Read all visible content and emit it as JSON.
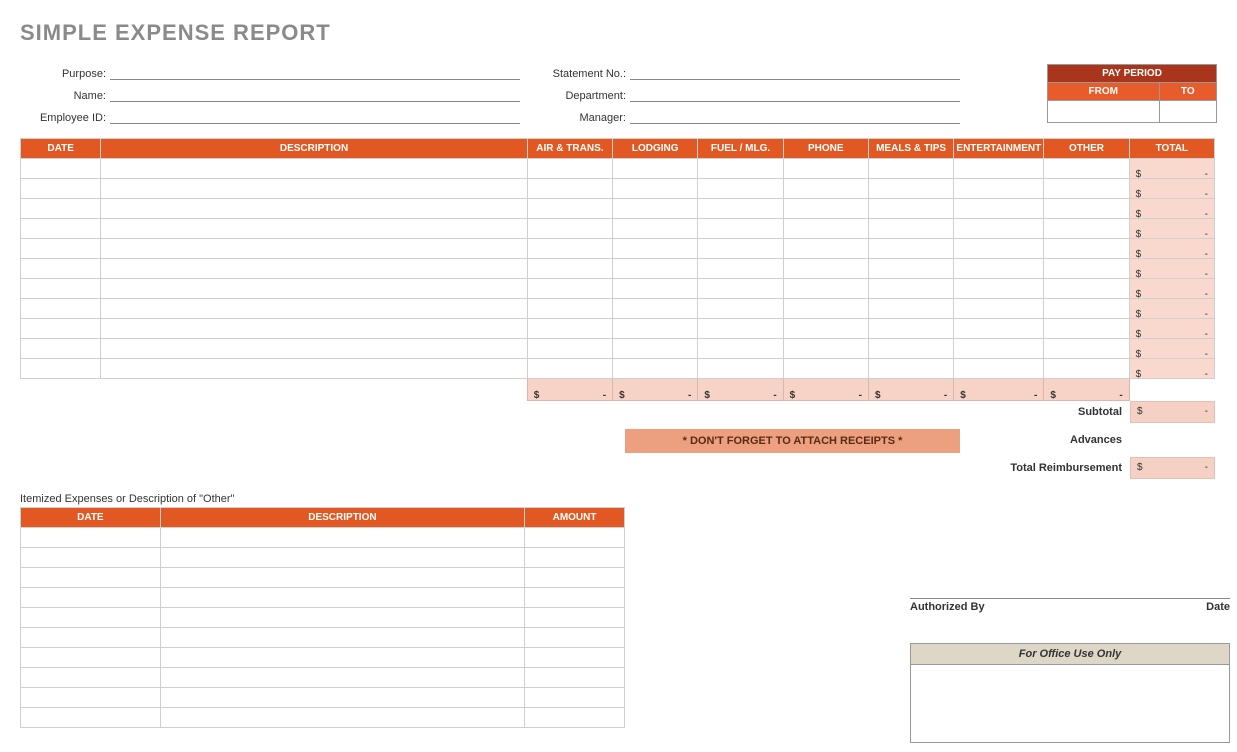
{
  "title": "SIMPLE EXPENSE REPORT",
  "info": {
    "left": [
      {
        "label": "Purpose:"
      },
      {
        "label": "Name:"
      },
      {
        "label": "Employee ID:"
      }
    ],
    "right": [
      {
        "label": "Statement No.:"
      },
      {
        "label": "Department:"
      },
      {
        "label": "Manager:"
      }
    ]
  },
  "pay_period": {
    "title": "PAY PERIOD",
    "from": "FROM",
    "to": "TO"
  },
  "main_cols": [
    "DATE",
    "DESCRIPTION",
    "AIR & TRANS.",
    "LODGING",
    "FUEL / MLG.",
    "PHONE",
    "MEALS & TIPS",
    "ENTERTAINMENT",
    "OTHER",
    "TOTAL"
  ],
  "main_rows": 11,
  "currency": "$",
  "dash": "-",
  "receipt_note": "* DON'T FORGET TO ATTACH RECEIPTS *",
  "summary": {
    "subtotal": "Subtotal",
    "advances": "Advances",
    "total_reimb": "Total Reimbursement"
  },
  "itemized_title": "Itemized Expenses or Description of \"Other\"",
  "itemized_cols": [
    "DATE",
    "DESCRIPTION",
    "AMOUNT"
  ],
  "itemized_rows": 10,
  "auth": {
    "by": "Authorized By",
    "date": "Date"
  },
  "office": "For Office Use Only"
}
